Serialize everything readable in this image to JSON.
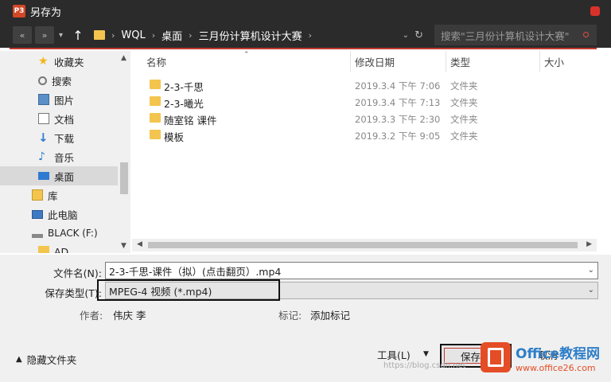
{
  "window": {
    "title": "另存为",
    "app_icon": "P3",
    "close_icon": "close-icon"
  },
  "address": {
    "crumbs": [
      "WQL",
      "桌面",
      "三月份计算机设计大赛"
    ],
    "search_placeholder": "搜索\"三月份计算机设计大赛\"",
    "accent_color": "#c23a2d"
  },
  "sidebar": {
    "items": [
      {
        "label": "收藏夹",
        "icon": "star-icon"
      },
      {
        "label": "搜索",
        "icon": "search-icon"
      },
      {
        "label": "图片",
        "icon": "picture-icon"
      },
      {
        "label": "文档",
        "icon": "document-icon"
      },
      {
        "label": "下载",
        "icon": "download-icon"
      },
      {
        "label": "音乐",
        "icon": "music-icon"
      },
      {
        "label": "桌面",
        "icon": "desktop-icon",
        "selected": true
      },
      {
        "label": "库",
        "icon": "library-icon"
      },
      {
        "label": "此电脑",
        "icon": "computer-icon"
      },
      {
        "label": "BLACK (F:)",
        "icon": "drive-icon"
      },
      {
        "label": "AD",
        "icon": "folder-icon"
      }
    ]
  },
  "files": {
    "columns": [
      "名称",
      "修改日期",
      "类型",
      "大小"
    ],
    "rows": [
      {
        "name": "2-3-千思",
        "date": "2019.3.4 下午 7:06",
        "type": "文件夹"
      },
      {
        "name": "2-3-曦光",
        "date": "2019.3.4 下午 7:13",
        "type": "文件夹"
      },
      {
        "name": "随室铭 课件",
        "date": "2019.3.3 下午 2:30",
        "type": "文件夹"
      },
      {
        "name": "模板",
        "date": "2019.3.2 下午 9:05",
        "type": "文件夹"
      }
    ]
  },
  "form": {
    "filename_label": "文件名(N):",
    "filename_value": "2-3-千思-课件（拟）(点击翻页）.mp4",
    "filetype_label": "保存类型(T):",
    "filetype_value": "MPEG-4 视频 (*.mp4)",
    "author_label": "作者:",
    "author_value": "伟庆 李",
    "tags_label": "标记:",
    "tags_value": "添加标记",
    "hide_folders": "隐藏文件夹",
    "tools_label": "工具(L)",
    "save_label": "保存(S)",
    "cancel_label": "取消"
  },
  "watermark": {
    "brand": "Office教程网",
    "url": "www.office26.com",
    "csdn": "https://blog.csdn.net"
  }
}
